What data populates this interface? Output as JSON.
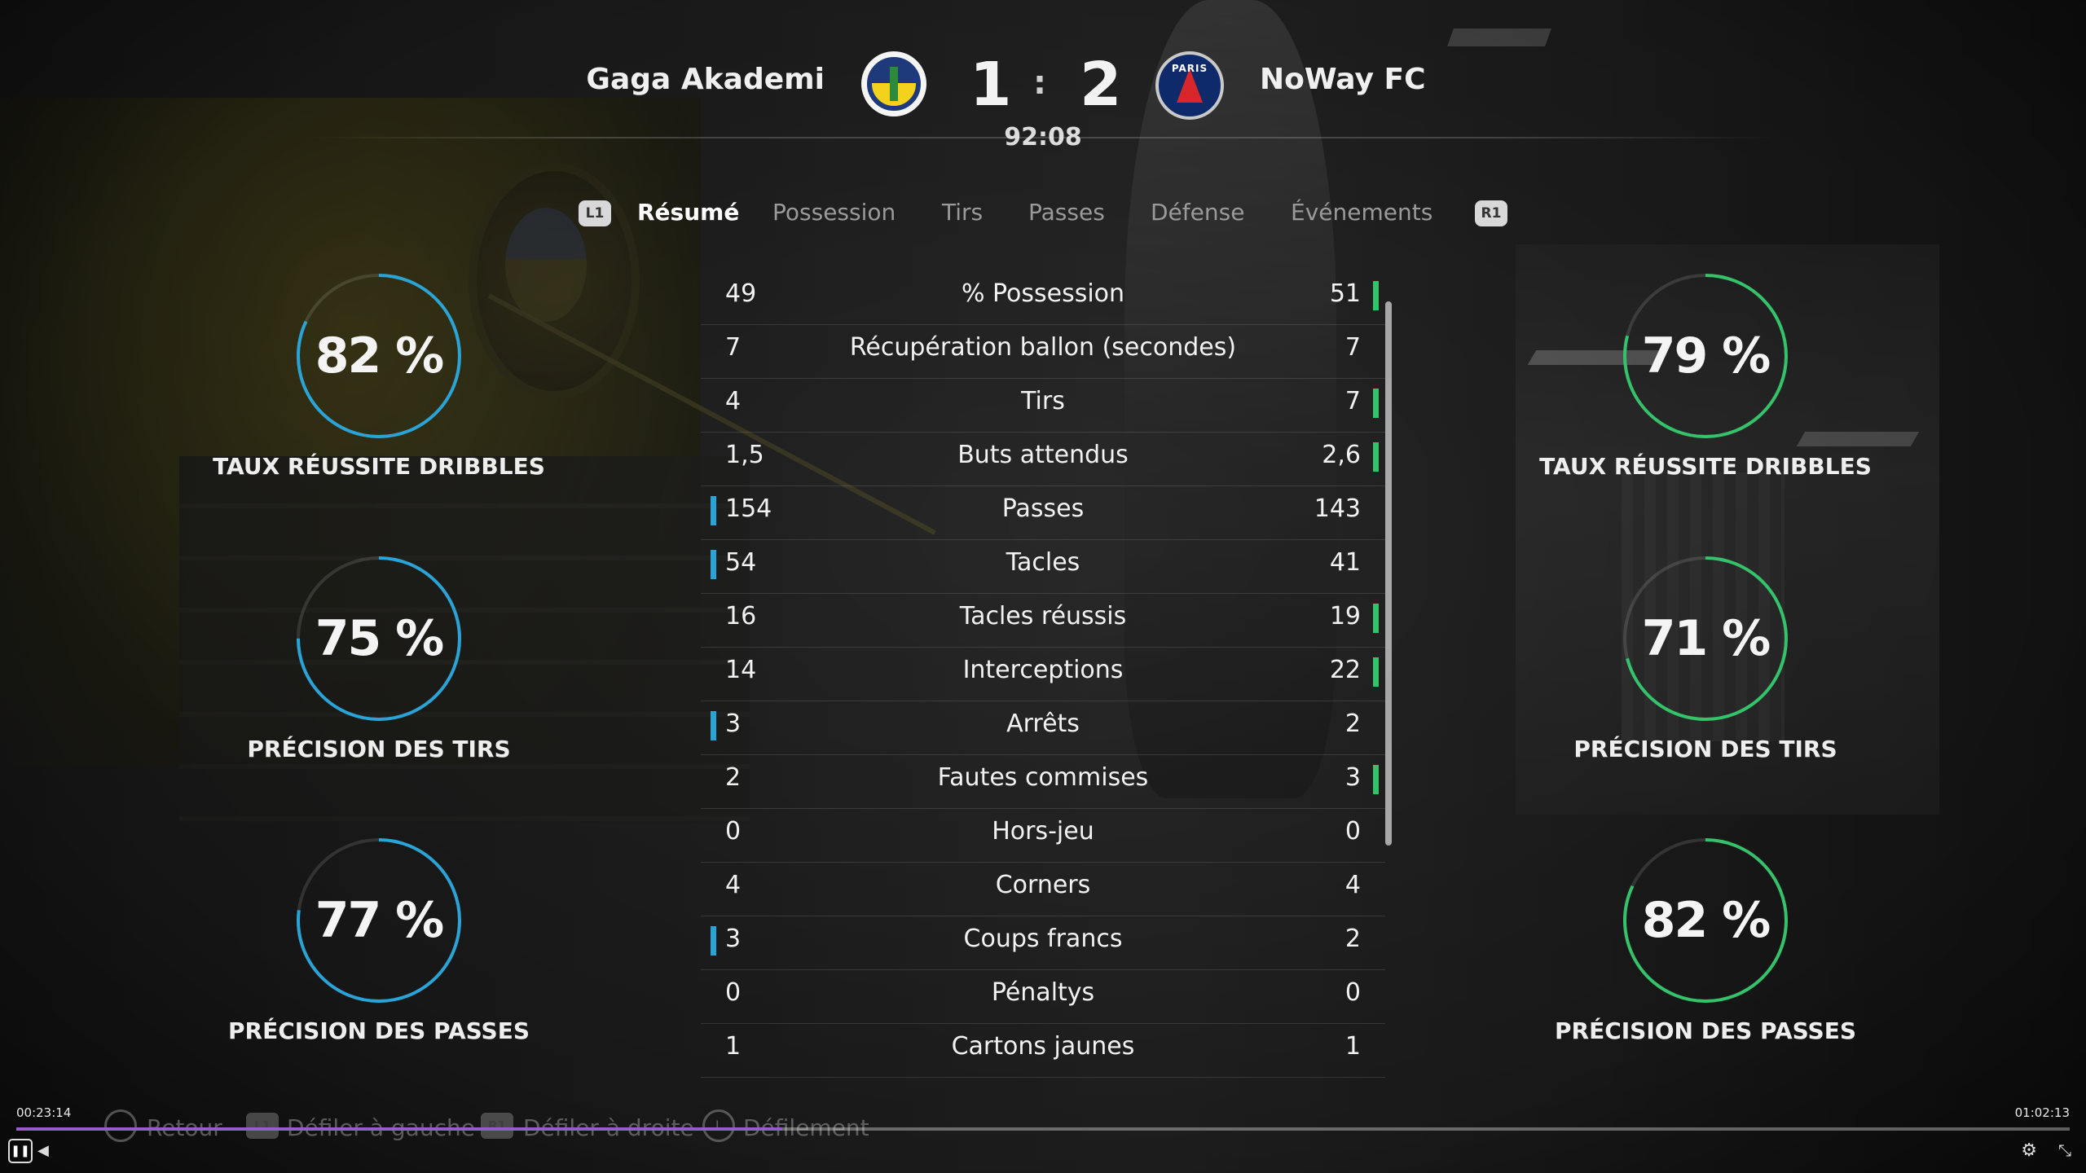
{
  "match": {
    "home_team": "Gaga Akademi",
    "away_team": "NoWay FC",
    "home_score": "1",
    "separator": ":",
    "away_score": "2",
    "clock": "92:08",
    "away_crest_text": "PARIS"
  },
  "tabs": {
    "left_button": "L1",
    "right_button": "R1",
    "items": [
      "Résumé",
      "Possession",
      "Tirs",
      "Passes",
      "Défense",
      "Événements"
    ],
    "active": "Résumé"
  },
  "home_circles": [
    {
      "value": "82 %",
      "percent": 82,
      "label": "TAUX RÉUSSITE DRIBBLES"
    },
    {
      "value": "75 %",
      "percent": 75,
      "label": "PRÉCISION DES TIRS"
    },
    {
      "value": "77 %",
      "percent": 77,
      "label": "PRÉCISION DES PASSES"
    }
  ],
  "away_circles": [
    {
      "value": "79 %",
      "percent": 79,
      "label": "TAUX RÉUSSITE DRIBBLES"
    },
    {
      "value": "71 %",
      "percent": 71,
      "label": "PRÉCISION DES TIRS"
    },
    {
      "value": "82 %",
      "percent": 82,
      "label": "PRÉCISION DES PASSES"
    }
  ],
  "stats": [
    {
      "name": "% Possession",
      "home": "49",
      "away": "51",
      "leader": "away"
    },
    {
      "name": "Récupération ballon (secondes)",
      "home": "7",
      "away": "7",
      "leader": "none"
    },
    {
      "name": "Tirs",
      "home": "4",
      "away": "7",
      "leader": "away"
    },
    {
      "name": "Buts attendus",
      "home": "1,5",
      "away": "2,6",
      "leader": "away"
    },
    {
      "name": "Passes",
      "home": "154",
      "away": "143",
      "leader": "home"
    },
    {
      "name": "Tacles",
      "home": "54",
      "away": "41",
      "leader": "home"
    },
    {
      "name": "Tacles réussis",
      "home": "16",
      "away": "19",
      "leader": "away"
    },
    {
      "name": "Interceptions",
      "home": "14",
      "away": "22",
      "leader": "away"
    },
    {
      "name": "Arrêts",
      "home": "3",
      "away": "2",
      "leader": "home"
    },
    {
      "name": "Fautes commises",
      "home": "2",
      "away": "3",
      "leader": "away"
    },
    {
      "name": "Hors-jeu",
      "home": "0",
      "away": "0",
      "leader": "none"
    },
    {
      "name": "Corners",
      "home": "4",
      "away": "4",
      "leader": "none"
    },
    {
      "name": "Coups francs",
      "home": "3",
      "away": "2",
      "leader": "home"
    },
    {
      "name": "Pénaltys",
      "home": "0",
      "away": "0",
      "leader": "none"
    },
    {
      "name": "Cartons jaunes",
      "home": "1",
      "away": "1",
      "leader": "none"
    }
  ],
  "footer_hints": {
    "back": "Retour",
    "scroll_left_button": "L1",
    "scroll_left": "Défiler à gauche",
    "scroll_right_button": "R1",
    "scroll_right": "Défiler à droite",
    "scroll_button": "L",
    "scroll": "Défilement"
  },
  "video": {
    "current_time": "00:23:14",
    "total_time": "01:02:13",
    "progress_fraction": 0.373
  },
  "colors": {
    "home_accent": "#2aa4d6",
    "away_accent": "#34c36a",
    "progress": "#9b59d0"
  }
}
